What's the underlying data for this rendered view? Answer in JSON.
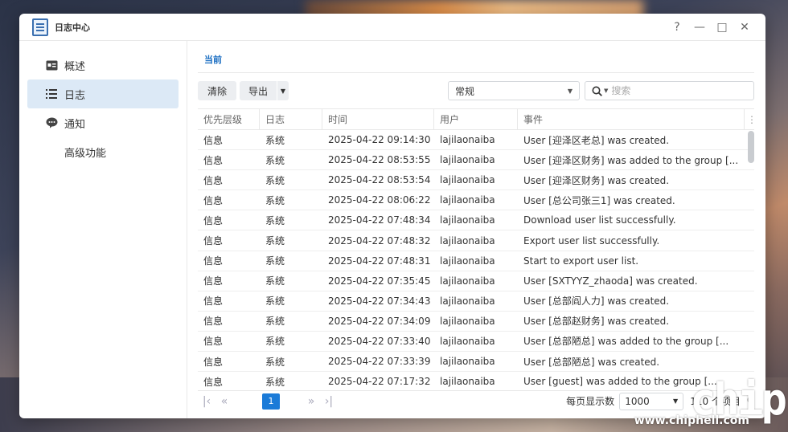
{
  "window": {
    "title": "日志中心",
    "controls": {
      "help": "?",
      "minimize": "—",
      "maximize": "□",
      "close": "✕"
    }
  },
  "sidebar": {
    "items": [
      {
        "label": "概述",
        "icon": "overview-icon"
      },
      {
        "label": "日志",
        "icon": "list-icon",
        "active": true
      },
      {
        "label": "通知",
        "icon": "chat-icon"
      },
      {
        "label": "高级功能",
        "icon": ""
      }
    ]
  },
  "tabs": [
    {
      "label": "当前",
      "active": true
    }
  ],
  "toolbar": {
    "clear_label": "清除",
    "export_label": "导出",
    "filter_select": "常规",
    "search_placeholder": "搜索"
  },
  "table": {
    "headers": [
      "优先层级",
      "日志",
      "时间",
      "用户",
      "事件"
    ],
    "rows": [
      [
        "信息",
        "系统",
        "2025-04-22 09:14:30",
        "lajilaonaiba",
        "User [迎泽区老总] was created."
      ],
      [
        "信息",
        "系统",
        "2025-04-22 08:53:55",
        "lajilaonaiba",
        "User [迎泽区财务] was added to the group [..."
      ],
      [
        "信息",
        "系统",
        "2025-04-22 08:53:54",
        "lajilaonaiba",
        "User [迎泽区财务] was created."
      ],
      [
        "信息",
        "系统",
        "2025-04-22 08:06:22",
        "lajilaonaiba",
        "User [总公司张三1] was created."
      ],
      [
        "信息",
        "系统",
        "2025-04-22 07:48:34",
        "lajilaonaiba",
        "Download user list successfully."
      ],
      [
        "信息",
        "系统",
        "2025-04-22 07:48:32",
        "lajilaonaiba",
        "Export user list successfully."
      ],
      [
        "信息",
        "系统",
        "2025-04-22 07:48:31",
        "lajilaonaiba",
        "Start to export user list."
      ],
      [
        "信息",
        "系统",
        "2025-04-22 07:35:45",
        "lajilaonaiba",
        "User [SXTYYZ_zhaoda] was created."
      ],
      [
        "信息",
        "系统",
        "2025-04-22 07:34:43",
        "lajilaonaiba",
        "User [总部阎人力] was created."
      ],
      [
        "信息",
        "系统",
        "2025-04-22 07:34:09",
        "lajilaonaiba",
        "User [总部赵财务] was created."
      ],
      [
        "信息",
        "系统",
        "2025-04-22 07:33:40",
        "lajilaonaiba",
        "User [总部陋总] was added to the group [..."
      ],
      [
        "信息",
        "系统",
        "2025-04-22 07:33:39",
        "lajilaonaiba",
        "User [总部陋总] was created."
      ],
      [
        "信息",
        "系统",
        "2025-04-22 07:17:32",
        "lajilaonaiba",
        "User [guest] was added to the group [..."
      ]
    ]
  },
  "pager": {
    "current_page": "1",
    "per_page_label": "每页显示数",
    "per_page_value": "1000",
    "count_text": "110 个项目"
  },
  "watermark": {
    "logo": "chip",
    "url": "www.chiphell.com"
  }
}
